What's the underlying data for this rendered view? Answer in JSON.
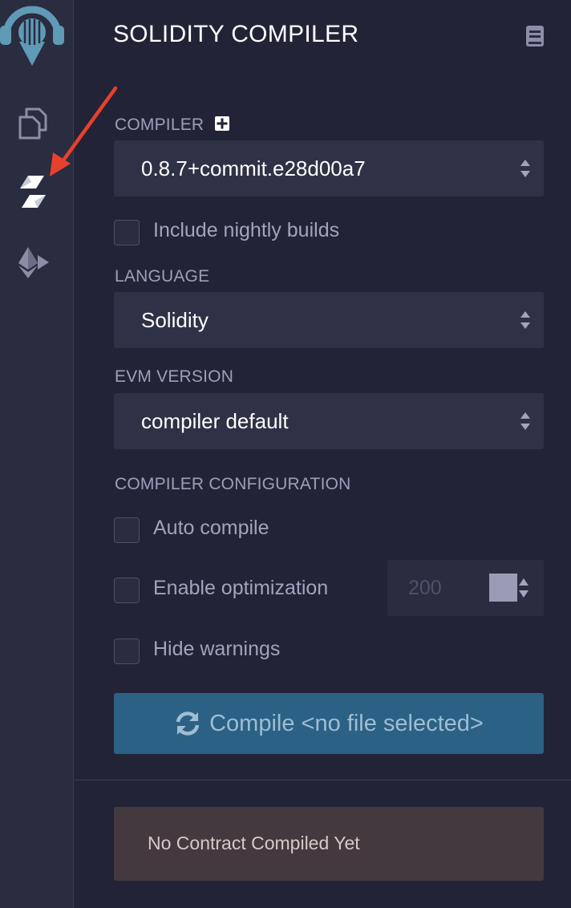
{
  "panel": {
    "title": "SOLIDITY COMPILER"
  },
  "rail": {
    "icons": [
      "remix-logo-icon",
      "file-explorer-icon",
      "solidity-compiler-icon",
      "deploy-run-icon"
    ],
    "annotation_color": "#e8402c"
  },
  "compiler": {
    "label": "COMPILER",
    "version": "0.8.7+commit.e28d00a7",
    "nightly_label": "Include nightly builds"
  },
  "language": {
    "label": "LANGUAGE",
    "value": "Solidity"
  },
  "evm": {
    "label": "EVM VERSION",
    "value": "compiler default"
  },
  "config": {
    "label": "COMPILER CONFIGURATION",
    "auto_compile": "Auto compile",
    "optimization": "Enable optimization",
    "runs": "200",
    "hide_warnings": "Hide warnings"
  },
  "compile_button": {
    "label": "Compile <no file selected>",
    "color": "#2b6184"
  },
  "status": {
    "message": "No Contract Compiled Yet"
  }
}
